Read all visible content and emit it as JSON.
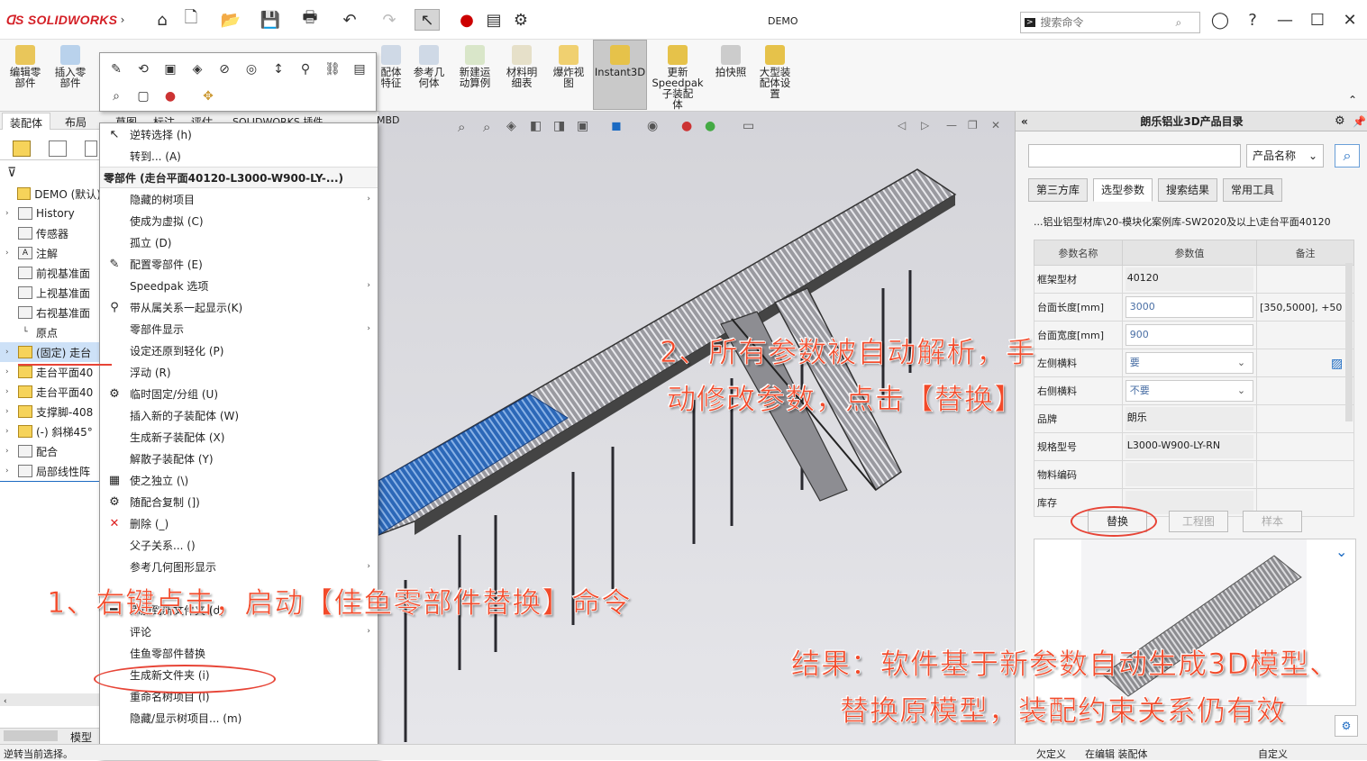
{
  "app": {
    "logo_text": "SOLIDWORKS",
    "window_title": "DEMO"
  },
  "search": {
    "placeholder": "搜索命令"
  },
  "ribbon": [
    {
      "label": "编辑零\n部件"
    },
    {
      "label": "插入零\n部件"
    },
    {
      "label": "配体\n特征"
    },
    {
      "label": "参考几\n何体"
    },
    {
      "label": "新建运\n动算例"
    },
    {
      "label": "材料明\n细表"
    },
    {
      "label": "爆炸视\n图"
    },
    {
      "label": "Instant3D"
    },
    {
      "label": "更新\nSpeedpak\n子装配\n体"
    },
    {
      "label": "拍快照"
    },
    {
      "label": "大型装\n配体设\n置"
    }
  ],
  "cmd_tabs": [
    "装配体",
    "布局",
    "草图",
    "标注",
    "评估",
    "SOLIDWORKS 插件",
    "MBD"
  ],
  "tree": [
    {
      "label": "DEMO (默认)",
      "exp": ""
    },
    {
      "label": "History",
      "exp": "›"
    },
    {
      "label": "传感器",
      "exp": ""
    },
    {
      "label": "注解",
      "exp": "›"
    },
    {
      "label": "前视基准面",
      "exp": ""
    },
    {
      "label": "上视基准面",
      "exp": ""
    },
    {
      "label": "右视基准面",
      "exp": ""
    },
    {
      "label": "原点",
      "exp": ""
    },
    {
      "label": "(固定) 走台",
      "exp": "›"
    },
    {
      "label": "走台平面40",
      "exp": "›"
    },
    {
      "label": "走台平面40",
      "exp": "›"
    },
    {
      "label": "支撑脚-408",
      "exp": "›"
    },
    {
      "label": "(-) 斜梯45°",
      "exp": "›"
    },
    {
      "label": "配合",
      "exp": "›"
    },
    {
      "label": "局部线性阵",
      "exp": "›"
    }
  ],
  "fm_bottom_tab": "模型",
  "status_left": "逆转当前选择。",
  "context_menu": {
    "top_items": [
      {
        "label": "逆转选择 (h)",
        "icon": "↖",
        "arrow": ""
      },
      {
        "label": "转到... (A)",
        "icon": "",
        "arrow": ""
      }
    ],
    "header": "零部件 (走台平面40120-L3000-W900-LY-...)",
    "items": [
      {
        "label": "隐藏的树项目",
        "icon": "",
        "arrow": "›"
      },
      {
        "label": "使成为虚拟 (C)",
        "icon": "",
        "arrow": ""
      },
      {
        "label": "孤立 (D)",
        "icon": "",
        "arrow": ""
      },
      {
        "label": "配置零部件 (E)",
        "icon": "✎",
        "arrow": ""
      },
      {
        "label": "Speedpak 选项",
        "icon": "",
        "arrow": "›"
      },
      {
        "label": "带从属关系一起显示(K)",
        "icon": "⚲",
        "arrow": ""
      },
      {
        "label": "零部件显示",
        "icon": "",
        "arrow": "›"
      },
      {
        "label": "设定还原到轻化 (P)",
        "icon": "",
        "arrow": ""
      },
      {
        "label": "浮动 (R)",
        "icon": "",
        "arrow": ""
      },
      {
        "label": "临时固定/分组 (U)",
        "icon": "⚙",
        "arrow": ""
      },
      {
        "label": "插入新的子装配体 (W)",
        "icon": "",
        "arrow": ""
      },
      {
        "label": "生成新子装配体 (X)",
        "icon": "",
        "arrow": ""
      },
      {
        "label": "解散子装配体 (Y)",
        "icon": "",
        "arrow": ""
      },
      {
        "label": "使之独立 (\\)",
        "icon": "▦",
        "arrow": ""
      },
      {
        "label": "随配合复制 (])",
        "icon": "⚙",
        "arrow": ""
      },
      {
        "label": "删除 (_)",
        "icon": "✕",
        "arrow": ""
      },
      {
        "label": "父子关系... ()",
        "icon": "",
        "arrow": ""
      },
      {
        "label": "参考几何图形显示",
        "icon": "",
        "arrow": "›"
      },
      {
        "label": "",
        "icon": "",
        "arrow": ""
      },
      {
        "label": "添加到新文件夹 (d)",
        "icon": "▬",
        "arrow": ""
      },
      {
        "label": "评论",
        "icon": "",
        "arrow": "›"
      },
      {
        "label": "佳鱼零部件替换",
        "icon": "",
        "arrow": ""
      },
      {
        "label": "生成新文件夹 (i)",
        "icon": "",
        "arrow": ""
      },
      {
        "label": "重命名树项目 (l)",
        "icon": "",
        "arrow": ""
      },
      {
        "label": "隐藏/显示树项目... (m)",
        "icon": "",
        "arrow": ""
      }
    ]
  },
  "panel": {
    "title": "朗乐铝业3D产品目录",
    "select_value": "产品名称",
    "tabs": [
      "第三方库",
      "选型参数",
      "搜索结果",
      "常用工具"
    ],
    "path": "...铝业铝型材库\\20-模块化案例库-SW2020及以上\\走台平面40120",
    "table_headers": [
      "参数名称",
      "参数值",
      "备注"
    ],
    "rows": [
      {
        "name": "框架型材",
        "value": "40120",
        "note": "",
        "kind": "ro"
      },
      {
        "name": "台面长度[mm]",
        "value": "3000",
        "note": "[350,5000], +50",
        "kind": "in"
      },
      {
        "name": "台面宽度[mm]",
        "value": "900",
        "note": "",
        "kind": "in"
      },
      {
        "name": "左侧横料",
        "value": "要",
        "note": "",
        "kind": "sel"
      },
      {
        "name": "右侧横料",
        "value": "不要",
        "note": "",
        "kind": "sel"
      },
      {
        "name": "品牌",
        "value": "朗乐",
        "note": "",
        "kind": "ro"
      },
      {
        "name": "规格型号",
        "value": "L3000-W900-LY-RN",
        "note": "",
        "kind": "ro"
      },
      {
        "name": "物料编码",
        "value": "",
        "note": "",
        "kind": "ro"
      },
      {
        "name": "库存",
        "value": "",
        "note": "",
        "kind": "ro"
      }
    ],
    "buttons": {
      "replace": "替换",
      "drawing": "工程图",
      "sample": "样本"
    }
  },
  "status_right": {
    "undefined": "欠定义",
    "editing": "在编辑 装配体",
    "custom": "自定义"
  },
  "annotations": {
    "a1": "1、右键点击，启动【佳鱼零部件替换】命令",
    "a2_line1": "2、所有参数被自动解析，手",
    "a2_line2": "动修改参数，点击【替换】",
    "a3_line1": "结果：软件基于新参数自动生成3D模型、",
    "a3_line2": "替换原模型，装配约束关系仍有效"
  },
  "colors": {
    "accent": "#1b6ac2",
    "annotation": "#f24a2a",
    "logo": "#d41f26"
  }
}
